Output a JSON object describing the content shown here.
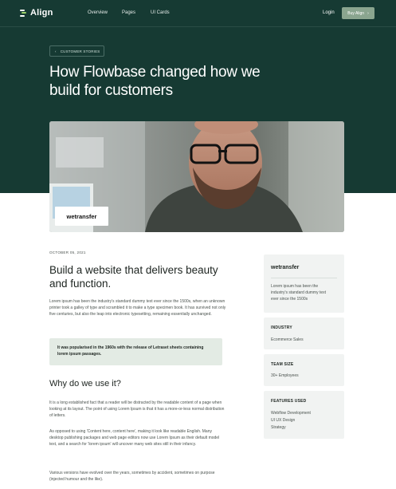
{
  "nav": {
    "logo": "Align",
    "links": [
      "Overview",
      "Pages",
      "UI Cards"
    ],
    "login": "Login",
    "buy_label": "Buy Align",
    "buy_arrow": "›"
  },
  "hero": {
    "tag_arrow": "‹",
    "tag": "CUSTOMER STORIES",
    "title": "How Flowbase changed how we build for customers",
    "photo_logo": "wetransfer"
  },
  "article": {
    "date": "OCTOBER 05, 2021",
    "heading": "Build a website that delivers beauty and function.",
    "intro": "Lorem ipsum has been the industry's standard dummy text ever since the 1500s, when an unknown printer took a galley of type and scrambled it to make a type specimen book. It has survived not only five centuries, but also the leap into electronic typesetting, remaining essentially unchanged.",
    "quote": "It was popularised in the 1960s with the release of Letraset sheets containing lorem ipsum passages.",
    "subheading": "Why do we use it?",
    "p1": "It is a long established fact that a reader will be distracted by the readable content of a page when looking at its layout. The point of using Lorem Ipsum is that it has a more-or-less normal distribution of letters.",
    "p2": "As opposed to using 'Content here, content here', making it look like readable English. Many desktop publishing packages and web page editors now use Lorem Ipsum as their default model text, and a search for 'lorem ipsum' will uncover many web sites still in their infancy.",
    "p3": "Various versions have evolved over the years, sometimes by accident, sometimes on purpose (injected humour and the like)."
  },
  "sidebar": {
    "brand": "wetransfer",
    "brand_text": "Lorem ipsum has been the industry's standard dummy text ever since the 1500s",
    "industry_title": "INDUSTRY",
    "industry_value": "Ecommerce Sales",
    "team_title": "TEAM SIZE",
    "team_value": "30+ Employees",
    "features_title": "FEATURES USED",
    "features": [
      "Webflow Development",
      "UI UX Design",
      "Strategy"
    ]
  }
}
